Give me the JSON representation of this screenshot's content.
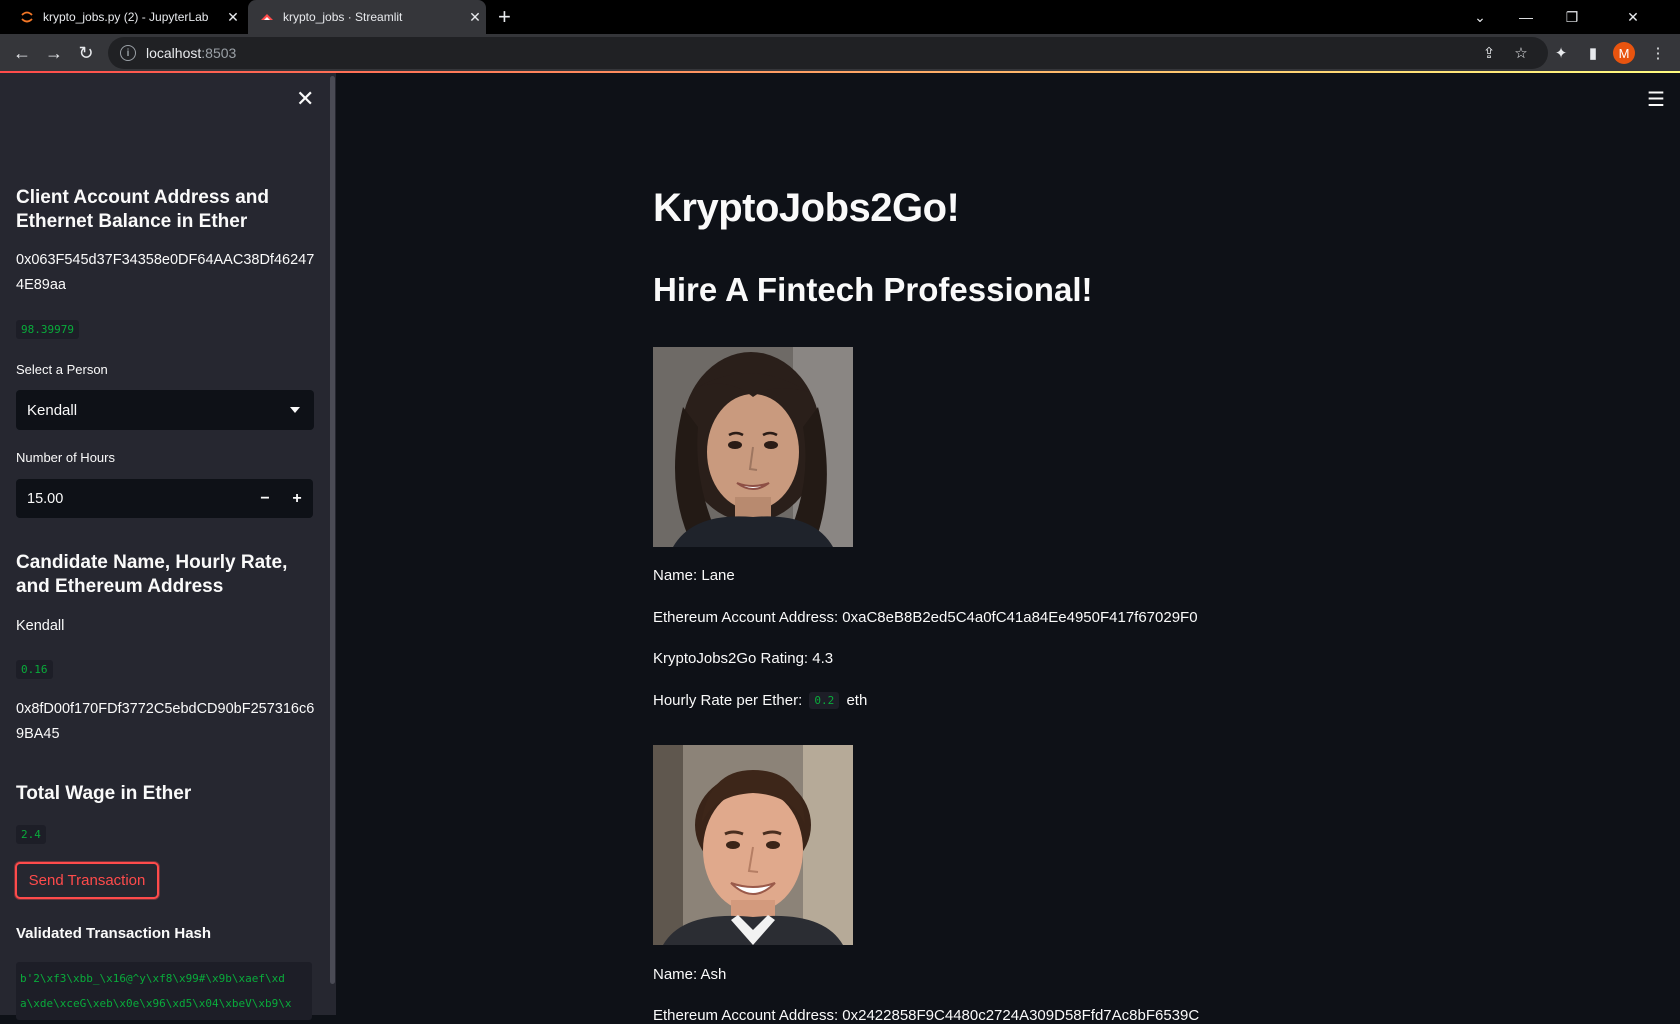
{
  "browser": {
    "tabs": [
      {
        "title": "krypto_jobs.py (2) - JupyterLab",
        "icon": "jupyter-icon"
      },
      {
        "title": "krypto_jobs · Streamlit",
        "icon": "streamlit-icon"
      }
    ],
    "url_host": "localhost",
    "url_port": ":8503",
    "profile_initial": "M"
  },
  "sidebar": {
    "client_heading": "Client Account Address and Ethernet Balance in Ether",
    "client_address": "0x063F545d37F34358e0DF64AAC38Df462474E89aa",
    "client_balance": "98.39979",
    "select_label": "Select a Person",
    "select_value": "Kendall",
    "hours_label": "Number of Hours",
    "hours_value": "15.00",
    "candidate_heading": "Candidate Name, Hourly Rate, and Ethereum Address",
    "candidate_name": "Kendall",
    "candidate_rate": "0.16",
    "candidate_address": "0x8fD00f170FDf3772C5ebdCD90bF257316c69BA45",
    "wage_heading": "Total Wage in Ether",
    "wage_value": "2.4",
    "send_button": "Send Transaction",
    "hash_heading": "Validated Transaction Hash",
    "hash_line1": "b'2\\xf3\\xbb_\\x16@^y\\xf8\\x99#\\x9b\\xaef\\xd",
    "hash_line2": "a\\xde\\xceG\\xeb\\x0e\\x96\\xd5\\x04\\xbeV\\xb9\\x"
  },
  "main": {
    "title": "KryptoJobs2Go!",
    "subtitle": "Hire A Fintech Professional!",
    "candidates": [
      {
        "name": "Name: Lane",
        "address": "Ethereum Account Address: 0xaC8eB8B2ed5C4a0fC41a84Ee4950F417f67029F0",
        "rating": "KryptoJobs2Go Rating: 4.3",
        "rate_prefix": "Hourly Rate per Ether:",
        "rate_value": "0.2",
        "rate_suffix": "eth"
      },
      {
        "name": "Name: Ash",
        "address": "Ethereum Account Address: 0x2422858F9C4480c2724A309D58Ffd7Ac8bF6539C"
      }
    ]
  }
}
